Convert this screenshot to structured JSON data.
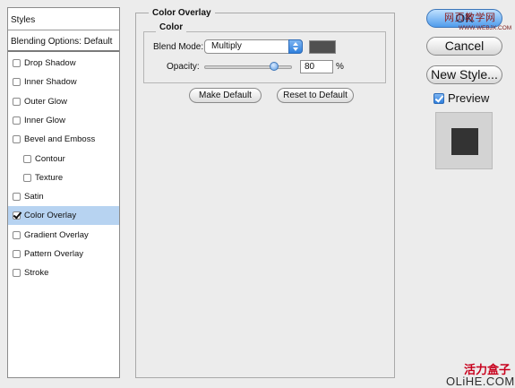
{
  "styles_panel": {
    "header": "Styles",
    "blending_options": "Blending Options: Default",
    "items": [
      {
        "label": "Drop Shadow",
        "checked": false,
        "indent": false,
        "selected": false
      },
      {
        "label": "Inner Shadow",
        "checked": false,
        "indent": false,
        "selected": false
      },
      {
        "label": "Outer Glow",
        "checked": false,
        "indent": false,
        "selected": false
      },
      {
        "label": "Inner Glow",
        "checked": false,
        "indent": false,
        "selected": false
      },
      {
        "label": "Bevel and Emboss",
        "checked": false,
        "indent": false,
        "selected": false
      },
      {
        "label": "Contour",
        "checked": false,
        "indent": true,
        "selected": false
      },
      {
        "label": "Texture",
        "checked": false,
        "indent": true,
        "selected": false
      },
      {
        "label": "Satin",
        "checked": false,
        "indent": false,
        "selected": false
      },
      {
        "label": "Color Overlay",
        "checked": true,
        "indent": false,
        "selected": true
      },
      {
        "label": "Gradient Overlay",
        "checked": false,
        "indent": false,
        "selected": false
      },
      {
        "label": "Pattern Overlay",
        "checked": false,
        "indent": false,
        "selected": false
      },
      {
        "label": "Stroke",
        "checked": false,
        "indent": false,
        "selected": false
      }
    ]
  },
  "color_overlay": {
    "group_title": "Color Overlay",
    "subgroup_title": "Color",
    "blend_mode_label": "Blend Mode:",
    "blend_mode_value": "Multiply",
    "overlay_color": "#505050",
    "opacity_label": "Opacity:",
    "opacity_value": "80",
    "opacity_unit": "%",
    "opacity_fraction": 0.8,
    "make_default_label": "Make Default",
    "reset_default_label": "Reset to Default"
  },
  "right_panel": {
    "ok_label": "OK",
    "cancel_label": "Cancel",
    "new_style_label": "New Style...",
    "preview_label": "Preview",
    "preview_checked": true,
    "preview_swatch_color": "#333333"
  },
  "watermarks": {
    "top_cn": "网页教学网",
    "top_url": "WWW.WEBJX.COM",
    "bottom_cn": "活力盒子",
    "bottom_en": "OLiHE.COM"
  }
}
